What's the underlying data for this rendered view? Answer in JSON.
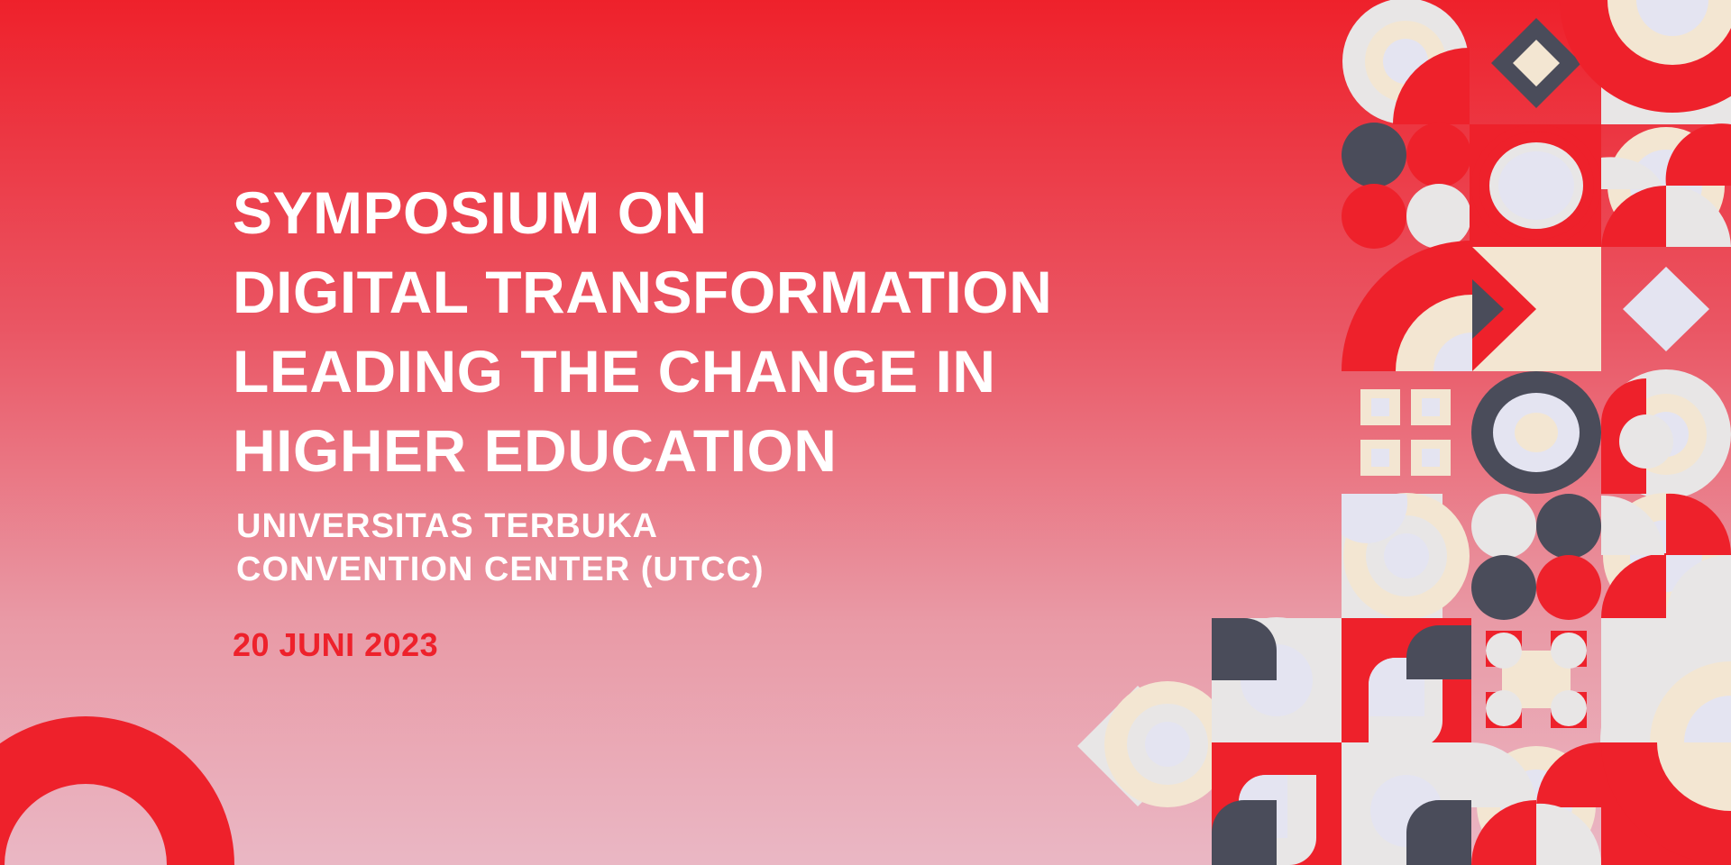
{
  "banner": {
    "title_lines": [
      "SYMPOSIUM ON",
      "DIGITAL TRANSFORMATION",
      "LEADING THE CHANGE IN",
      "HIGHER EDUCATION"
    ],
    "venue_lines": [
      "UNIVERSITAS TERBUKA",
      "CONVENTION CENTER (UTCC)"
    ],
    "date": "20 JUNI 2023"
  },
  "colors": {
    "brand_red": "#ee212b",
    "light_gray": "#e8e6e6",
    "cream": "#f3e6d2",
    "lavender": "#e4e4f1",
    "slate": "#4a4c5a",
    "white": "#ffffff"
  }
}
